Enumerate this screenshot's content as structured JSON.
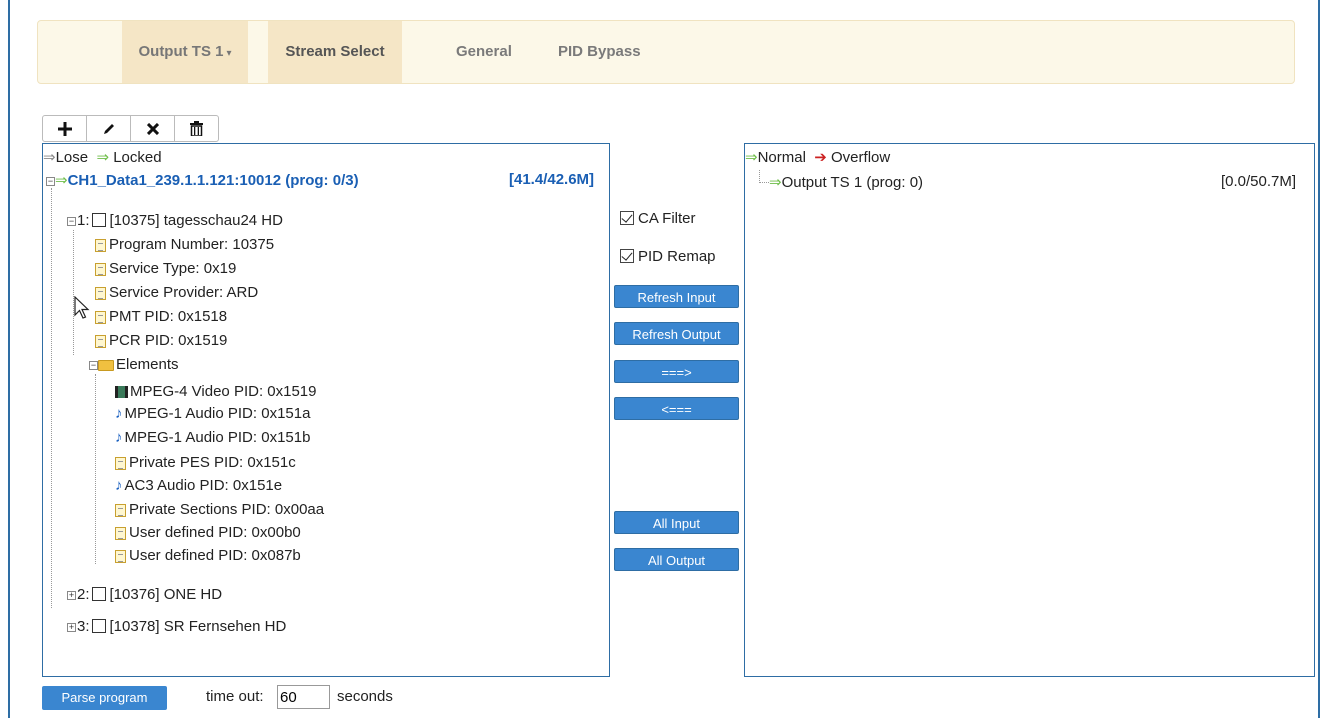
{
  "nav": {
    "output_tab": "Output TS 1",
    "tabs": [
      {
        "label": "Stream Select"
      },
      {
        "label": "General"
      },
      {
        "label": "PID Bypass"
      }
    ]
  },
  "toolbar": {
    "icons": [
      "plus-icon",
      "pencil-icon",
      "x-icon",
      "trash-icon"
    ]
  },
  "input_panel": {
    "legend_lose": "Lose",
    "legend_locked": "Locked",
    "source": {
      "label": "CH1_Data1_239.1.1.121:10012 (prog: 0/3)",
      "rate": "[41.4/42.6M]"
    },
    "program1": {
      "label": "[10375] tagesschau24 HD",
      "number": "1:",
      "details": [
        "Program Number: 10375",
        "Service Type: 0x19",
        "Service Provider: ARD",
        "PMT PID: 0x1518",
        "PCR PID: 0x1519"
      ],
      "elements_label": "Elements",
      "elements": [
        {
          "icon": "video",
          "label": "MPEG-4 Video PID: 0x1519"
        },
        {
          "icon": "audio",
          "label": "MPEG-1 Audio PID: 0x151a"
        },
        {
          "icon": "audio",
          "label": "MPEG-1 Audio PID: 0x151b"
        },
        {
          "icon": "doc",
          "label": "Private PES PID: 0x151c"
        },
        {
          "icon": "audio",
          "label": "AC3 Audio PID: 0x151e"
        },
        {
          "icon": "doc",
          "label": "Private Sections PID: 0x00aa"
        },
        {
          "icon": "doc",
          "label": "User defined PID: 0x00b0"
        },
        {
          "icon": "doc",
          "label": "User defined PID: 0x087b"
        }
      ]
    },
    "program2": {
      "number": "2:",
      "label": "[10376] ONE HD"
    },
    "program3": {
      "number": "3:",
      "label": "[10378] SR Fernsehen HD"
    }
  },
  "controls": {
    "ca_filter": "CA Filter",
    "pid_remap": "PID Remap",
    "refresh_input": "Refresh Input",
    "refresh_output": "Refresh Output",
    "move_right": "===>",
    "move_left": "<===",
    "all_input": "All Input",
    "all_output": "All Output"
  },
  "output_panel": {
    "legend_normal": "Normal",
    "legend_overflow": "Overflow",
    "output": {
      "label": "Output TS 1 (prog: 0)",
      "rate": "[0.0/50.7M]"
    }
  },
  "footer": {
    "parse_button": "Parse program",
    "timeout_label": "time out:",
    "timeout_value": "60",
    "seconds_label": "seconds"
  },
  "colors": {
    "accent": "#3a86d0",
    "tab_bg": "#f5e6c6",
    "link_blue": "#1a5fb4",
    "arrow_green": "#6fbe4a",
    "arrow_red": "#cc2222"
  }
}
